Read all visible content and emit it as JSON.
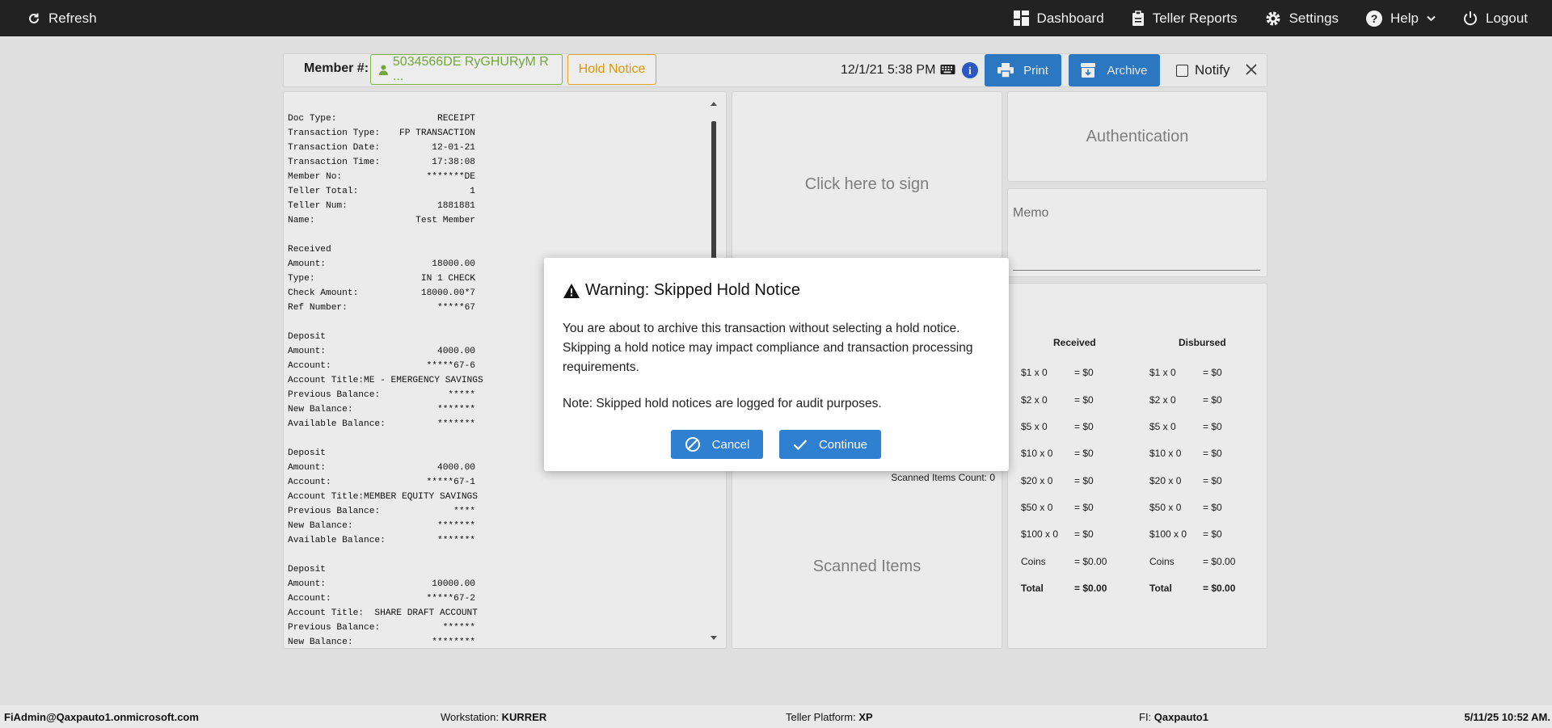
{
  "nav": {
    "refresh_label": "Refresh",
    "dashboard_label": "Dashboard",
    "teller_reports_label": "Teller Reports",
    "settings_label": "Settings",
    "help_label": "Help",
    "logout_label": "Logout"
  },
  "header": {
    "member_label": "Member #:",
    "member_value": "5034566DE RyGHURyM R ...",
    "hold_notice_label": "Hold Notice",
    "datetime": "12/1/21 5:38 PM",
    "print_label": "Print",
    "archive_label": "Archive",
    "notify_label": "Notify"
  },
  "receipt": {
    "lines": [
      {
        "k": "Doc Type:",
        "v": "RECEIPT"
      },
      {
        "k": "Transaction Type:",
        "v": "FP TRANSACTION"
      },
      {
        "k": "Transaction Date:",
        "v": "12-01-21"
      },
      {
        "k": "Transaction Time:",
        "v": "17:38:08"
      },
      {
        "k": "Member No:",
        "v": "*******DE"
      },
      {
        "k": "Teller Total:",
        "v": "1"
      },
      {
        "k": "Teller Num:",
        "v": "1881881"
      },
      {
        "k": "Name:",
        "v": "Test Member"
      },
      {
        "k": "",
        "v": ""
      },
      {
        "k": "Received",
        "v": ""
      },
      {
        "k": "Amount:",
        "v": "18000.00"
      },
      {
        "k": "Type:",
        "v": "IN 1 CHECK"
      },
      {
        "k": "Check Amount:",
        "v": "18000.00*7"
      },
      {
        "k": "Ref Number:",
        "v": "*****67"
      },
      {
        "k": "",
        "v": ""
      },
      {
        "k": "Deposit",
        "v": ""
      },
      {
        "k": "Amount:",
        "v": "4000.00"
      },
      {
        "k": "Account:",
        "v": "*****67-6"
      },
      {
        "k": "Account Title:ME - EMERGENCY SAVINGS",
        "v": ""
      },
      {
        "k": "Previous Balance:",
        "v": "*****"
      },
      {
        "k": "New Balance:",
        "v": "*******"
      },
      {
        "k": "Available Balance:",
        "v": "*******"
      },
      {
        "k": "",
        "v": ""
      },
      {
        "k": "Deposit",
        "v": ""
      },
      {
        "k": "Amount:",
        "v": "4000.00"
      },
      {
        "k": "Account:",
        "v": "*****67-1"
      },
      {
        "k": "Account Title:MEMBER EQUITY SAVINGS",
        "v": ""
      },
      {
        "k": "Previous Balance:",
        "v": "****"
      },
      {
        "k": "New Balance:",
        "v": "*******"
      },
      {
        "k": "Available Balance:",
        "v": "*******"
      },
      {
        "k": "",
        "v": ""
      },
      {
        "k": "Deposit",
        "v": ""
      },
      {
        "k": "Amount:",
        "v": "10000.00"
      },
      {
        "k": "Account:",
        "v": "*****67-2"
      },
      {
        "k": "Account Title:  SHARE DRAFT ACCOUNT",
        "v": ""
      },
      {
        "k": "Previous Balance:",
        "v": "******"
      },
      {
        "k": "New Balance:",
        "v": "********"
      }
    ]
  },
  "sign": {
    "click_to_sign": "Click here to sign",
    "scanned_count": "Scanned Items Count: 0",
    "scanned_items": "Scanned Items"
  },
  "auth": {
    "title": "Authentication"
  },
  "memo": {
    "label": "Memo"
  },
  "cash": {
    "received_header": "Received",
    "disbursed_header": "Disbursed",
    "received": [
      {
        "label": "$1 x 0",
        "value": "= $0"
      },
      {
        "label": "$2 x 0",
        "value": "= $0"
      },
      {
        "label": "$5 x 0",
        "value": "= $0"
      },
      {
        "label": "$10 x 0",
        "value": "= $0"
      },
      {
        "label": "$20 x 0",
        "value": "= $0"
      },
      {
        "label": "$50 x 0",
        "value": "= $0"
      },
      {
        "label": "$100 x 0",
        "value": "= $0"
      },
      {
        "label": "Coins",
        "value": "= $0.00"
      },
      {
        "label": "Total",
        "value": "= $0.00"
      }
    ],
    "disbursed": [
      {
        "label": "$1 x 0",
        "value": "= $0"
      },
      {
        "label": "$2 x 0",
        "value": "= $0"
      },
      {
        "label": "$5 x 0",
        "value": "= $0"
      },
      {
        "label": "$10 x 0",
        "value": "= $0"
      },
      {
        "label": "$20 x 0",
        "value": "= $0"
      },
      {
        "label": "$50 x 0",
        "value": "= $0"
      },
      {
        "label": "$100 x 0",
        "value": "= $0"
      },
      {
        "label": "Coins",
        "value": "= $0.00"
      },
      {
        "label": "Total",
        "value": "= $0.00"
      }
    ]
  },
  "modal": {
    "title": "Warning: Skipped Hold Notice",
    "body": "You are about to archive this transaction without selecting a hold notice. Skipping a hold notice may impact compliance and transaction processing requirements.",
    "note": "Note: Skipped hold notices are logged for audit purposes.",
    "cancel_label": "Cancel",
    "continue_label": "Continue"
  },
  "footer": {
    "user": "FiAdmin@Qaxpauto1.onmicrosoft.com",
    "workstation_label": "Workstation:",
    "workstation_value": "KURRER",
    "platform_label": "Teller Platform:",
    "platform_value": "XP",
    "fi_label": "FI:",
    "fi_value": "Qaxpauto1",
    "timestamp": "5/11/25 10:52 AM."
  },
  "colors": {
    "nav_bg": "#222222",
    "primary": "#2f80d1",
    "member_green": "#7cb342",
    "hold_orange": "#f0a500"
  }
}
